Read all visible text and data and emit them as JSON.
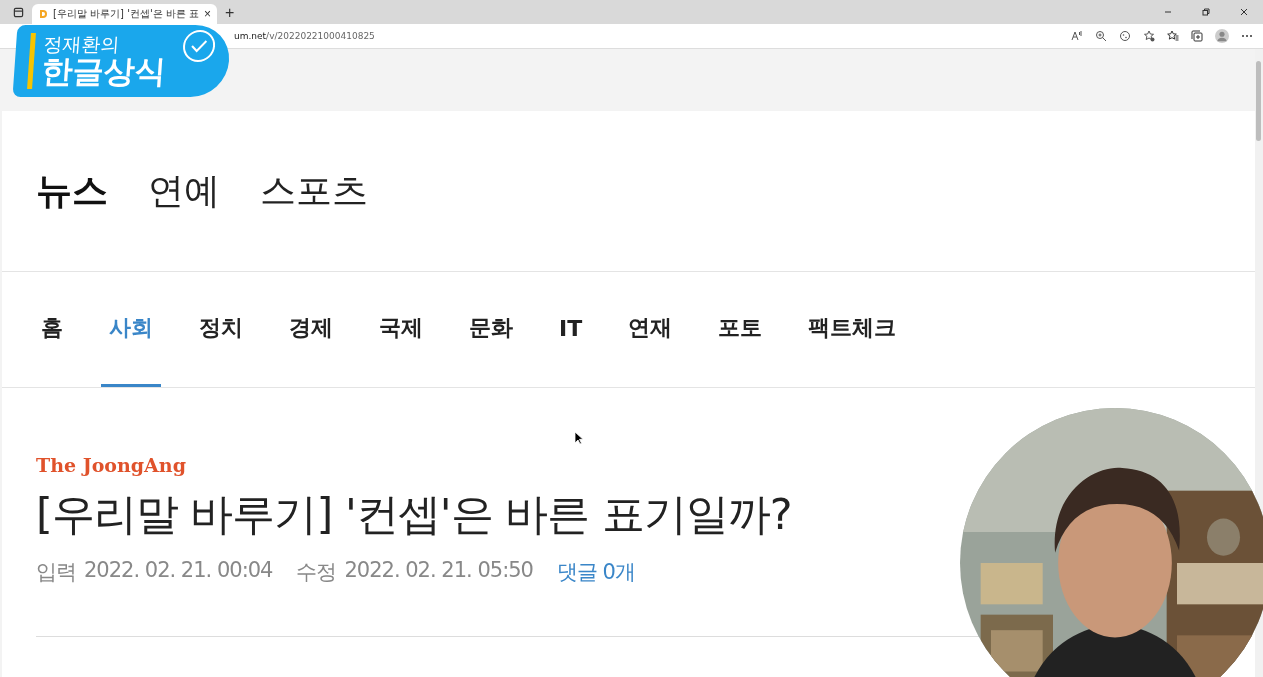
{
  "browser": {
    "tab_title": "[우리말 바루기] '컨셉'은 바른 표",
    "tab_close": "×",
    "new_tab": "+",
    "url_host": "um.net",
    "url_path": "/v/20220221000410825"
  },
  "overlay": {
    "line_1": "정재환의",
    "line_2": "한글상식"
  },
  "service_tabs": [
    {
      "label": "뉴스",
      "selected": true
    },
    {
      "label": "연예",
      "selected": false
    },
    {
      "label": "스포츠",
      "selected": false
    }
  ],
  "categories": [
    {
      "label": "홈",
      "selected": false
    },
    {
      "label": "사회",
      "selected": true
    },
    {
      "label": "정치",
      "selected": false
    },
    {
      "label": "경제",
      "selected": false
    },
    {
      "label": "국제",
      "selected": false
    },
    {
      "label": "문화",
      "selected": false
    },
    {
      "label": "IT",
      "selected": false
    },
    {
      "label": "연재",
      "selected": false
    },
    {
      "label": "포토",
      "selected": false
    },
    {
      "label": "팩트체크",
      "selected": false
    }
  ],
  "article": {
    "source": "The JoongAng",
    "title": "[우리말 바루기] '컨셉'은 바른 표기일까?",
    "input_label": "입력",
    "input_time": "2022. 02. 21. 00:04",
    "modified_label": "수정",
    "modified_time": "2022. 02. 21. 05:50",
    "comments": "댓글 0개"
  }
}
